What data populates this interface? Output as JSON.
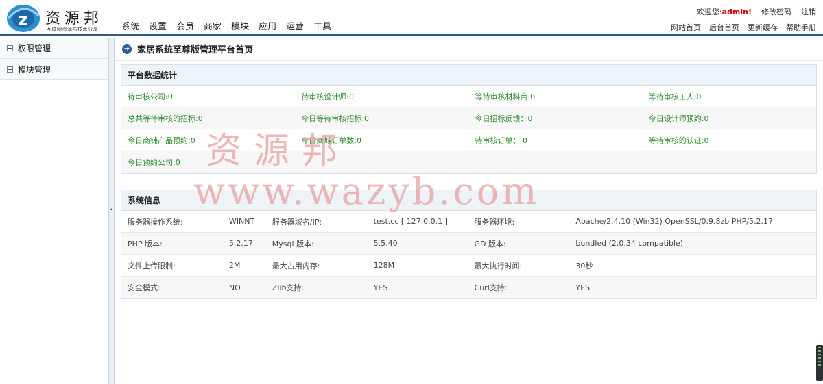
{
  "header": {
    "logo_title": "资源邦",
    "logo_subtitle": "互联网资源与技术分享",
    "nav": [
      "系统",
      "设置",
      "会员",
      "商家",
      "模块",
      "应用",
      "运营",
      "工具"
    ],
    "welcome": "欢迎您:",
    "username": "admin!",
    "change_password": "修改密码",
    "logout": "注销",
    "links": [
      "网站首页",
      "后台首页",
      "更新缓存",
      "帮助手册"
    ]
  },
  "sidebar": {
    "items": [
      {
        "label": "权限管理"
      },
      {
        "label": "模块管理"
      }
    ]
  },
  "main": {
    "page_title": "家居系统至尊版管理平台首页",
    "stats_panel": {
      "title": "平台数据统计",
      "rows": [
        [
          "待审核公司:0",
          "待审核设计师:0",
          "等待审核材料商:0",
          "等待审核工人:0"
        ],
        [
          "总共等待审核的招标:0",
          "今日等待审核招标:0",
          "今日招标反馈：0",
          "今日设计师预约:0"
        ],
        [
          "今日商铺产品预约:0",
          "今日商城订单数:0",
          "待审核订单： 0",
          "等待审核的认证:0"
        ],
        [
          "今日预约公司:0",
          "",
          "",
          ""
        ]
      ]
    },
    "system_panel": {
      "title": "系统信息",
      "rows": [
        [
          "服务器操作系统:",
          "WINNT",
          "服务器域名/IP:",
          "test.cc [ 127.0.0.1 ]",
          "服务器环境:",
          "Apache/2.4.10 (Win32) OpenSSL/0.9.8zb PHP/5.2.17"
        ],
        [
          "PHP 版本:",
          "5.2.17",
          "Mysql 版本:",
          "5.5.40",
          "GD 版本:",
          "bundled (2.0.34 compatible)"
        ],
        [
          "文件上传限制:",
          "2M",
          "最大占用内存:",
          "128M",
          "最大执行时间:",
          "30秒"
        ],
        [
          "安全模式:",
          "NO",
          "Zlib支持:",
          "YES",
          "Curl支持:",
          "YES"
        ]
      ]
    }
  },
  "watermark": {
    "line1": "资源邦",
    "line2": "www.wazyb.com"
  },
  "colors": {
    "accent": "#2d5b86",
    "stat_text": "#2a8a2a",
    "admin": "#d40000",
    "watermark": "#e9a0a0"
  }
}
